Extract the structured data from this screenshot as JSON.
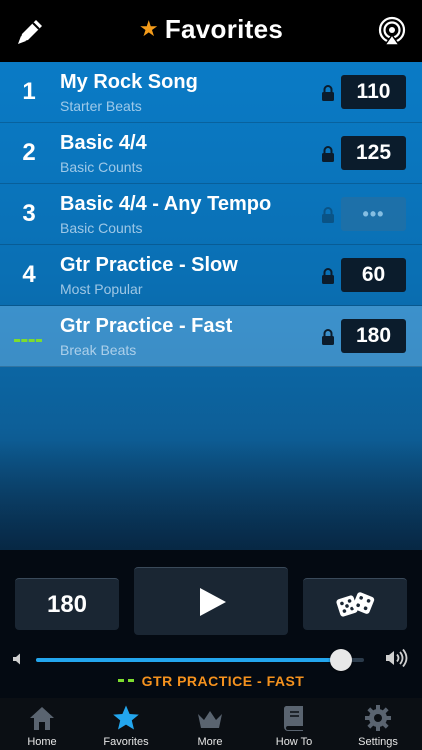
{
  "header": {
    "title": "Favorites",
    "edit_icon": "pencil-icon",
    "cast_icon": "airplay-icon"
  },
  "favorites": [
    {
      "index": "1",
      "name": "My Rock Song",
      "category": "Starter Beats",
      "tempo": "110",
      "locked": true
    },
    {
      "index": "2",
      "name": "Basic 4/4",
      "category": "Basic Counts",
      "tempo": "125",
      "locked": true
    },
    {
      "index": "3",
      "name": "Basic 4/4 - Any Tempo",
      "category": "Basic Counts",
      "tempo": "•••",
      "locked": false
    },
    {
      "index": "4",
      "name": "Gtr Practice - Slow",
      "category": "Most Popular",
      "tempo": "60",
      "locked": true
    },
    {
      "index": "",
      "name": "Gtr Practice - Fast",
      "category": "Break Beats",
      "tempo": "180",
      "locked": true,
      "playing": true
    }
  ],
  "controls": {
    "tempo": "180",
    "volume_fraction": 0.93,
    "now_playing": "GTR PRACTICE - FAST"
  },
  "tabs": [
    {
      "label": "Home",
      "icon": "house-icon"
    },
    {
      "label": "Favorites",
      "icon": "star-icon",
      "active": true
    },
    {
      "label": "More",
      "icon": "crown-icon"
    },
    {
      "label": "How To",
      "icon": "book-icon"
    },
    {
      "label": "Settings",
      "icon": "gear-icon"
    }
  ],
  "colors": {
    "accent_blue": "#23a6ee",
    "star_orange": "#f59c1a",
    "now_playing_orange": "#f5921e",
    "playing_green": "#7ddc2f"
  }
}
